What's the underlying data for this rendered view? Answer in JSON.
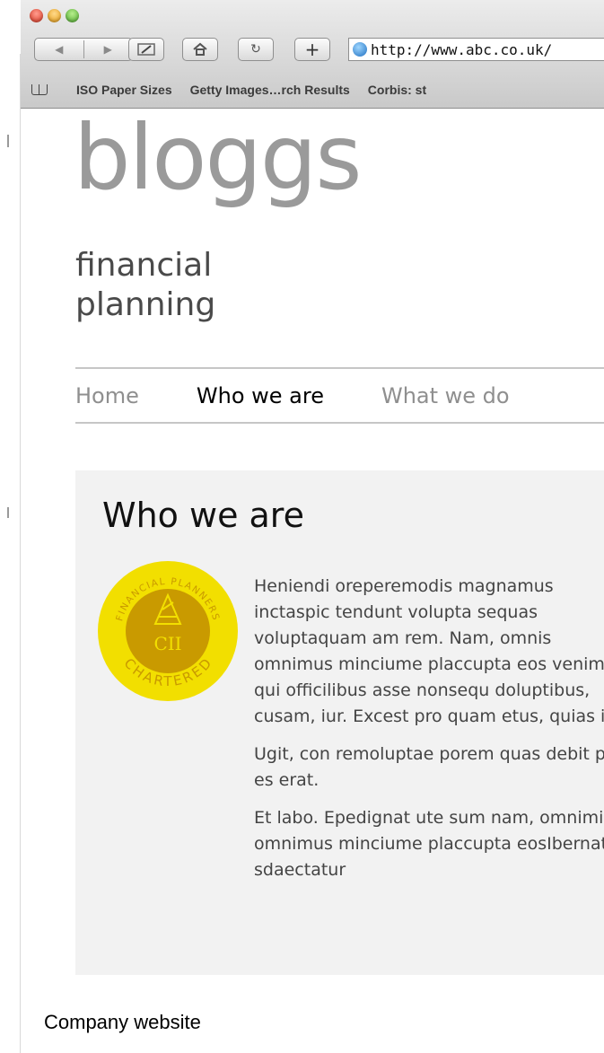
{
  "browser": {
    "url": "http://www.abc.co.uk/",
    "bookmarks": [
      "ISO Paper Sizes",
      "Getty Images…rch Results",
      "Corbis: st"
    ]
  },
  "site": {
    "logo_title": "bloggs",
    "logo_subtitle": "financial planning",
    "nav": [
      "Home",
      "Who we are",
      "What we do"
    ],
    "nav_active": "Who we are"
  },
  "main": {
    "heading": "Who we are",
    "badge": {
      "top_text": "FINANCIAL PLANNERS",
      "center_text": "CII",
      "bottom_text": "CHARTERED",
      "colors": {
        "outer": "#f2df00",
        "inner": "#c99a00",
        "text": "#e6b800"
      }
    },
    "paragraphs": [
      "Heniendi oreperemodis magnamus inctaspic tendunt volupta sequas voluptaquam am rem. Nam, omnis omnimus minciume placcupta eos venim qui officilibus asse nonsequ doluptibus, cusam, iur. Excest pro quam etus, quias int.",
      "Ugit, con remoluptae porem quas debit pro es erat.",
      "Et labo. Epedignat ute sum nam, omnimi, omnimus minciume placcupta eosIbernatu sdaectatur"
    ]
  },
  "caption": "Company website"
}
